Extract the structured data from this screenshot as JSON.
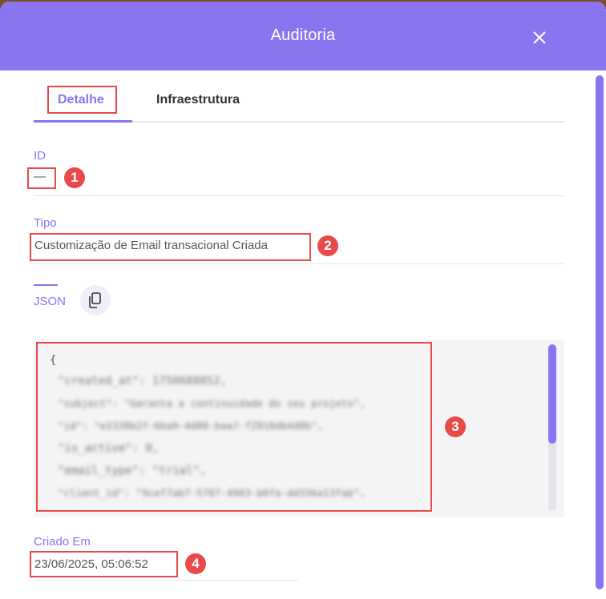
{
  "modal": {
    "title": "Auditoria"
  },
  "tabs": [
    {
      "label": "Detalhe",
      "active": true
    },
    {
      "label": "Infraestrutura",
      "active": false
    }
  ],
  "fields": {
    "id": {
      "label": "ID",
      "value": "—"
    },
    "tipo": {
      "label": "Tipo",
      "value": "Customização de Email transacional Criada"
    },
    "json": {
      "label": "JSON"
    },
    "criado_em": {
      "label": "Criado Em",
      "value": "23/06/2025, 05:06:52"
    }
  },
  "json_lines": [
    "{",
    "\"created_at\": 1750688852,",
    "\"subject\": \"Garanta a continuidade do seu projeto\",",
    "\"id\": \"e2338b2f-6ba9-4d80-baa7-f2918db4d0b\",",
    "\"is_active\": 0,",
    "\"email_type\": \"trial\",",
    "\"client_id\": \"9cef7ab7-5707-4903-b0fa-dd336a13fab\","
  ],
  "annotations": [
    "1",
    "2",
    "3",
    "4"
  ],
  "icons": {
    "close": "close-icon",
    "copy": "copy-icon"
  },
  "colors": {
    "accent": "#8b74f0",
    "highlight": "#e84a4a"
  }
}
